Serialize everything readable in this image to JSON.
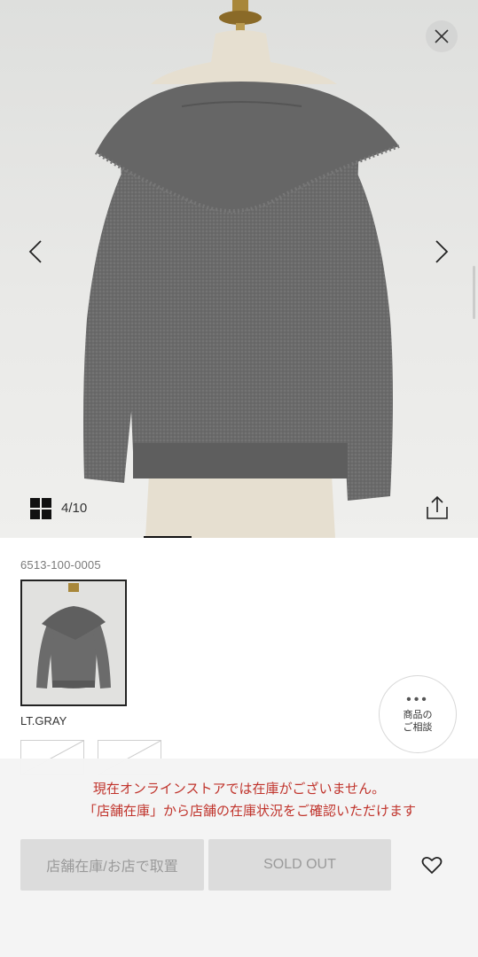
{
  "gallery": {
    "counter": "4/10",
    "image_alt": "Gray knit cardigan with ruffled collar on dress form, back view",
    "icons": {
      "close": "close-icon",
      "prev": "chevron-left-icon",
      "next": "chevron-right-icon",
      "grid": "grid-icon",
      "share": "share-icon"
    }
  },
  "product": {
    "code": "6513-100-0005",
    "color_name": "LT.GRAY"
  },
  "consult": {
    "dots": "•••",
    "line1": "商品の",
    "line2": "ご相談"
  },
  "notice": {
    "line1": "現在オンラインストアでは在庫がございません。",
    "line2": "「店舗在庫」から店舗の在庫状況をご確認いただけます"
  },
  "actions": {
    "store_stock_label": "店舗在庫/お店で取置",
    "sold_out_label": "SOLD OUT",
    "favorite_icon": "heart-icon"
  },
  "colors": {
    "notice_red": "#c0332b",
    "disabled_button": "#dcdcdc",
    "progress_indicator": "#111111"
  }
}
